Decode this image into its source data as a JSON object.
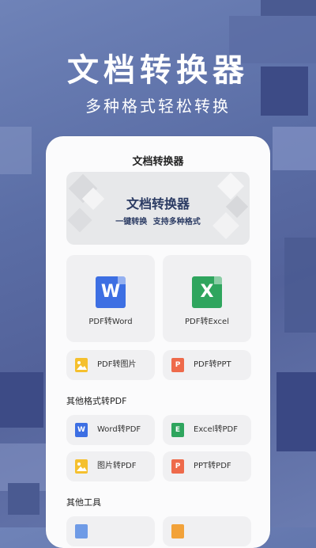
{
  "hero": {
    "title": "文档转换器",
    "subtitle": "多种格式轻松转换"
  },
  "app": {
    "title": "文档转换器",
    "banner": {
      "title": "文档转换器",
      "subtitle": "一键转换  支持多种格式"
    },
    "main_tools": [
      {
        "label": "PDF转Word",
        "icon": "word-doc-icon",
        "icon_letter": "W",
        "color": "#3d6fe3"
      },
      {
        "label": "PDF转Excel",
        "icon": "excel-doc-icon",
        "icon_letter": "X",
        "color": "#2fa55e"
      }
    ],
    "pdf_tools": [
      {
        "label": "PDF转图片",
        "icon": "image-icon",
        "color": "#f5c02e"
      },
      {
        "label": "PDF转PPT",
        "icon": "ppt-icon",
        "icon_letter": "P",
        "color": "#ee6a4b"
      }
    ],
    "section_other_formats": "其他格式转PDF",
    "other_format_tools": [
      {
        "label": "Word转PDF",
        "icon": "word-icon",
        "icon_letter": "W",
        "color": "#3d6fe3"
      },
      {
        "label": "Excel转PDF",
        "icon": "excel-icon",
        "icon_letter": "E",
        "color": "#2fa55e"
      },
      {
        "label": "图片转PDF",
        "icon": "image-icon",
        "color": "#f5c02e"
      },
      {
        "label": "PPT转PDF",
        "icon": "ppt-icon",
        "icon_letter": "P",
        "color": "#ee6a4b"
      }
    ],
    "section_other_tools": "其他工具"
  }
}
